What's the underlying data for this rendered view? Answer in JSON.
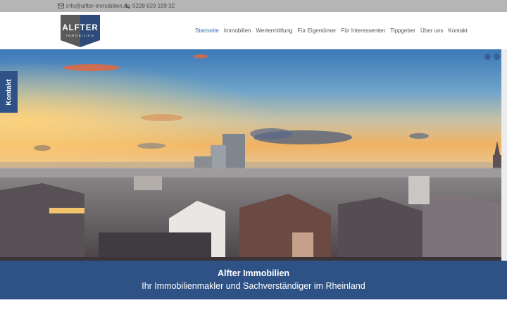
{
  "topbar": {
    "email": "info@alfter-immobilien.de",
    "phone": "0228 629 199 32",
    "email_icon": "envelope-icon",
    "phone_icon": "phone-icon"
  },
  "logo": {
    "brand": "ALFTER",
    "sub": "IMMOBILIEN"
  },
  "nav": {
    "items": [
      "Startseite",
      "Immobilien",
      "Wertermittlung",
      "Für Eigentümer",
      "Für Interessenten",
      "Tippgeber",
      "Über uns",
      "Kontakt"
    ],
    "active_index": 0
  },
  "side_tab": {
    "label": "Kontakt"
  },
  "hero": {
    "slider_dots": 2
  },
  "band": {
    "title": "Alfter Immobilien",
    "subtitle": "Ihr Immobilienmakler und Sachverständiger im Rheinland"
  },
  "colors": {
    "brand_blue": "#2e5285",
    "active_link": "#3d6fb1",
    "topbar": "#b5b5b5"
  }
}
